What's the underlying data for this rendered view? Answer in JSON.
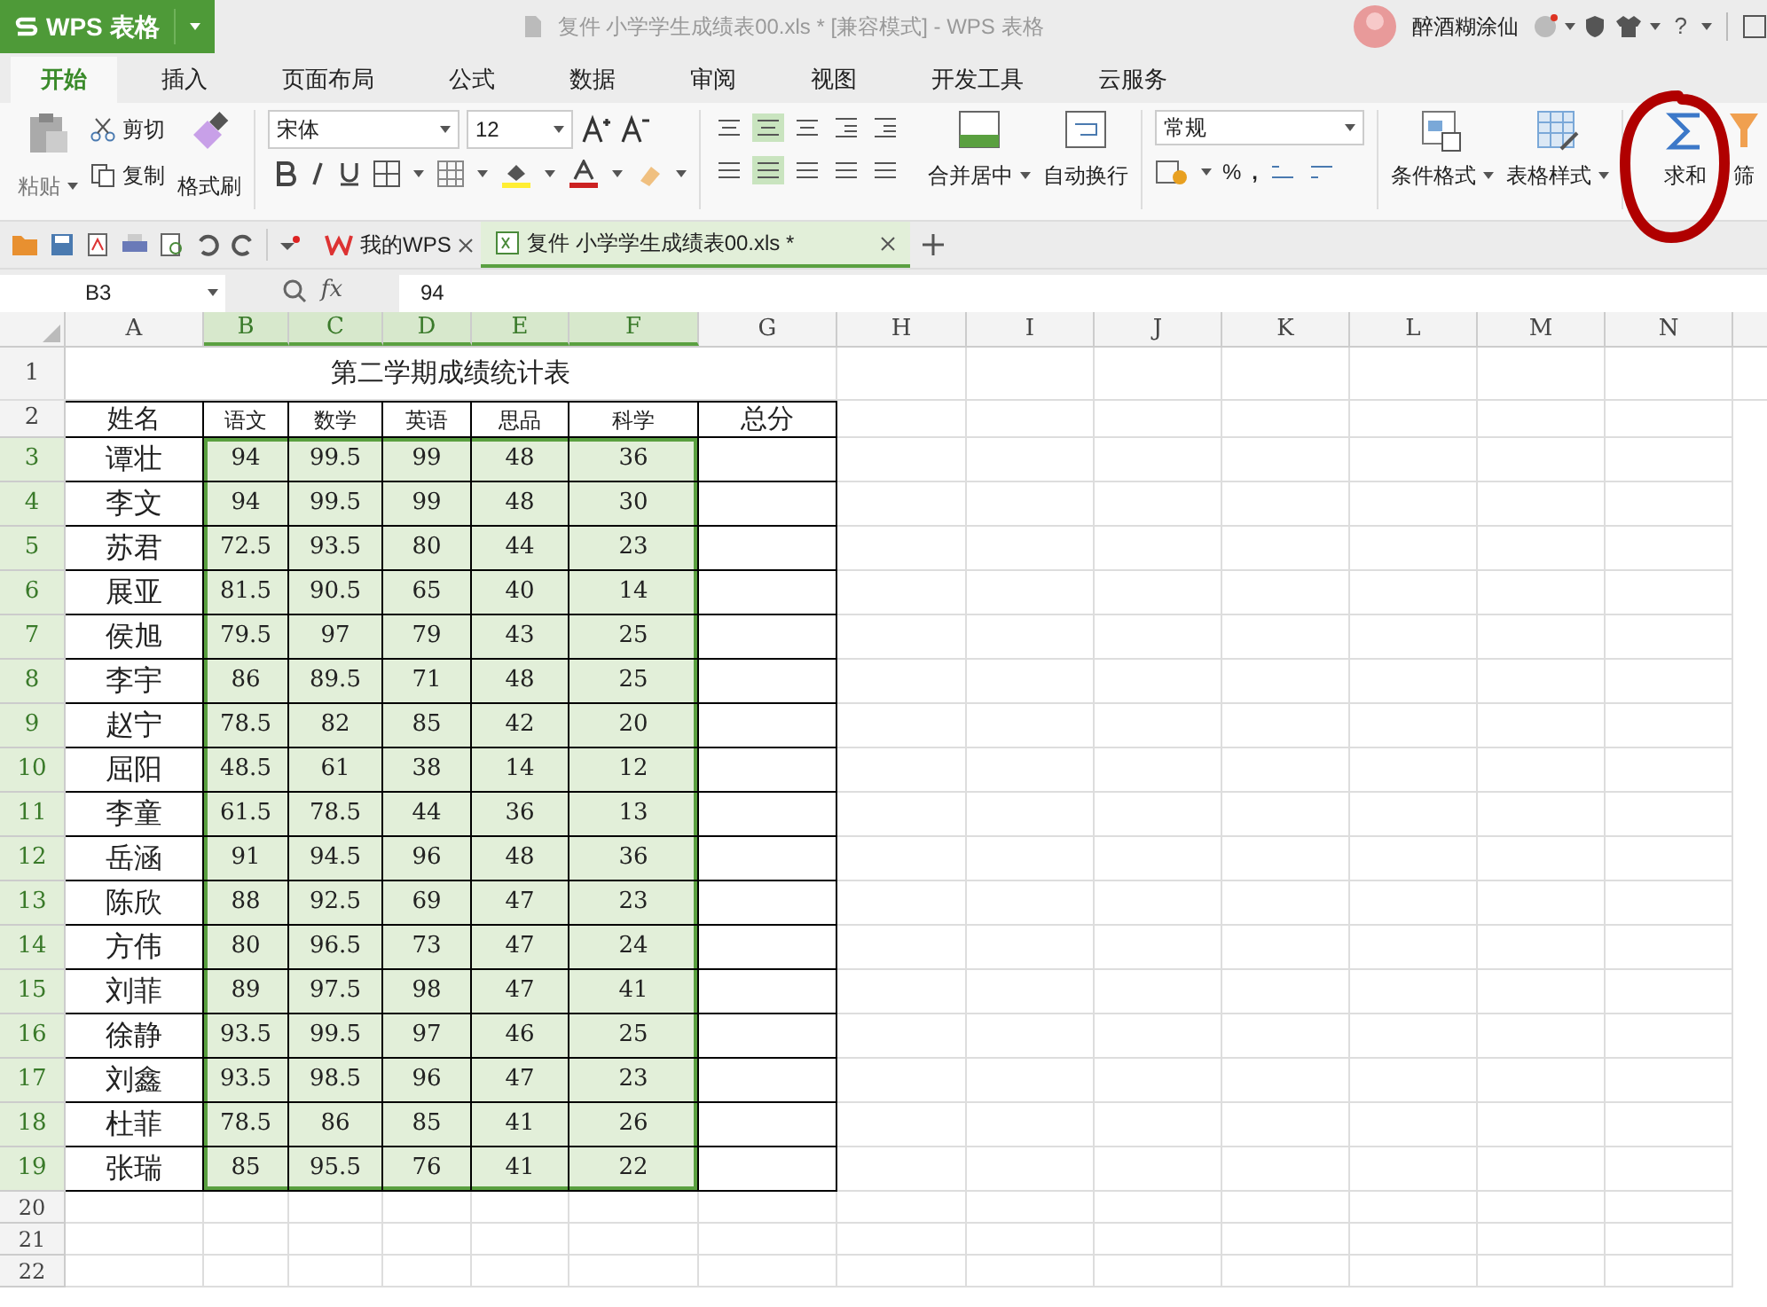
{
  "title_bar": {
    "app_name": "WPS 表格",
    "document_title": "复件 小学学生成绩表00.xls * [兼容模式] - WPS 表格",
    "user_name": "醉酒糊涂仙",
    "help": "?"
  },
  "menu_tabs": [
    {
      "label": "开始",
      "selected": true
    },
    {
      "label": "插入",
      "selected": false
    },
    {
      "label": "页面布局",
      "selected": false
    },
    {
      "label": "公式",
      "selected": false
    },
    {
      "label": "数据",
      "selected": false
    },
    {
      "label": "审阅",
      "selected": false
    },
    {
      "label": "视图",
      "selected": false
    },
    {
      "label": "开发工具",
      "selected": false
    },
    {
      "label": "云服务",
      "selected": false
    }
  ],
  "ribbon": {
    "paste": "粘贴",
    "cut": "剪切",
    "copy": "复制",
    "format_painter": "格式刷",
    "font_name": "宋体",
    "font_size": "12",
    "merge_center": "合并居中",
    "wrap_text": "自动换行",
    "number_format": "常规",
    "percent": "%",
    "comma": ",",
    "conditional_format": "条件格式",
    "table_style": "表格样式",
    "sum": "求和",
    "filter": "筛"
  },
  "doc_tabs": [
    {
      "label": "我的WPS",
      "kind": "home",
      "selected": false
    },
    {
      "label": "复件 小学学生成绩表00.xls *",
      "kind": "sheet",
      "selected": true
    }
  ],
  "formula_bar": {
    "cell_ref": "B3",
    "fx": "fx",
    "value": "94"
  },
  "sheet": {
    "columns": [
      {
        "label": "A",
        "selected": false
      },
      {
        "label": "B",
        "selected": true
      },
      {
        "label": "C",
        "selected": true
      },
      {
        "label": "D",
        "selected": true
      },
      {
        "label": "E",
        "selected": true
      },
      {
        "label": "F",
        "selected": true
      },
      {
        "label": "G",
        "selected": false
      },
      {
        "label": "H",
        "selected": false
      },
      {
        "label": "I",
        "selected": false
      },
      {
        "label": "J",
        "selected": false
      },
      {
        "label": "K",
        "selected": false
      },
      {
        "label": "L",
        "selected": false
      },
      {
        "label": "M",
        "selected": false
      },
      {
        "label": "N",
        "selected": false
      }
    ],
    "title_row": {
      "number": "1",
      "text": "第二学期成绩统计表"
    },
    "header_row": {
      "number": "2",
      "cells": [
        "姓名",
        "语文",
        "数学",
        "英语",
        "思品",
        "科学",
        "总分"
      ]
    },
    "rows": [
      {
        "number": "3",
        "selected": true,
        "cells": [
          "谭壮",
          "94",
          "99.5",
          "99",
          "48",
          "36"
        ]
      },
      {
        "number": "4",
        "selected": true,
        "cells": [
          "李文",
          "94",
          "99.5",
          "99",
          "48",
          "30"
        ]
      },
      {
        "number": "5",
        "selected": true,
        "cells": [
          "苏君",
          "72.5",
          "93.5",
          "80",
          "44",
          "23"
        ]
      },
      {
        "number": "6",
        "selected": true,
        "cells": [
          "展亚",
          "81.5",
          "90.5",
          "65",
          "40",
          "14"
        ]
      },
      {
        "number": "7",
        "selected": true,
        "cells": [
          "侯旭",
          "79.5",
          "97",
          "79",
          "43",
          "25"
        ]
      },
      {
        "number": "8",
        "selected": true,
        "cells": [
          "李宇",
          "86",
          "89.5",
          "71",
          "48",
          "25"
        ]
      },
      {
        "number": "9",
        "selected": true,
        "cells": [
          "赵宁",
          "78.5",
          "82",
          "85",
          "42",
          "20"
        ]
      },
      {
        "number": "10",
        "selected": true,
        "cells": [
          "屈阳",
          "48.5",
          "61",
          "38",
          "14",
          "12"
        ]
      },
      {
        "number": "11",
        "selected": true,
        "cells": [
          "李童",
          "61.5",
          "78.5",
          "44",
          "36",
          "13"
        ]
      },
      {
        "number": "12",
        "selected": true,
        "cells": [
          "岳涵",
          "91",
          "94.5",
          "96",
          "48",
          "36"
        ]
      },
      {
        "number": "13",
        "selected": true,
        "cells": [
          "陈欣",
          "88",
          "92.5",
          "69",
          "47",
          "23"
        ]
      },
      {
        "number": "14",
        "selected": true,
        "cells": [
          "方伟",
          "80",
          "96.5",
          "73",
          "47",
          "24"
        ]
      },
      {
        "number": "15",
        "selected": true,
        "cells": [
          "刘菲",
          "89",
          "97.5",
          "98",
          "47",
          "41"
        ]
      },
      {
        "number": "16",
        "selected": true,
        "cells": [
          "徐静",
          "93.5",
          "99.5",
          "97",
          "46",
          "25"
        ]
      },
      {
        "number": "17",
        "selected": true,
        "cells": [
          "刘鑫",
          "93.5",
          "98.5",
          "96",
          "47",
          "23"
        ]
      },
      {
        "number": "18",
        "selected": true,
        "cells": [
          "杜菲",
          "78.5",
          "86",
          "85",
          "41",
          "26"
        ]
      },
      {
        "number": "19",
        "selected": true,
        "cells": [
          "张瑞",
          "85",
          "95.5",
          "76",
          "41",
          "22"
        ]
      }
    ],
    "empty_rows": [
      "20",
      "21",
      "22"
    ]
  }
}
